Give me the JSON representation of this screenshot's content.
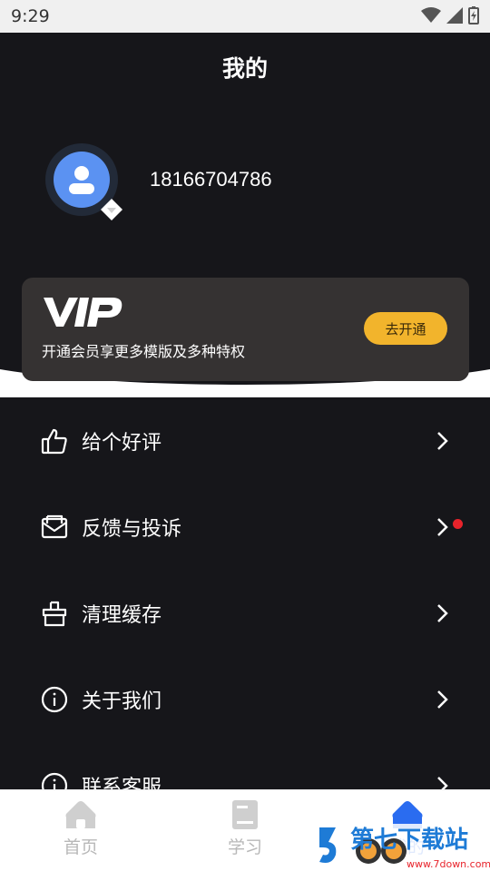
{
  "status_bar": {
    "time": "9:29"
  },
  "header": {
    "title": "我的"
  },
  "profile": {
    "phone": "18166704786"
  },
  "vip_card": {
    "logo_text": "VIP",
    "subtitle": "开通会员享更多模版及多种特权",
    "button_label": "去开通"
  },
  "menu": {
    "items": [
      {
        "label": "给个好评",
        "icon": "thumbs-up-icon"
      },
      {
        "label": "反馈与投诉",
        "icon": "feedback-mail-icon",
        "badge": "red-dot"
      },
      {
        "label": "清理缓存",
        "icon": "broom-icon"
      },
      {
        "label": "关于我们",
        "icon": "info-icon"
      },
      {
        "label": "联系客服",
        "icon": "info-icon"
      }
    ]
  },
  "bottom_nav": {
    "items": [
      {
        "label": "首页",
        "icon": "home-icon"
      },
      {
        "label": "学习",
        "icon": "book-icon"
      },
      {
        "label": "我的",
        "icon": "profile-house-icon",
        "active": true
      }
    ]
  },
  "watermark": {
    "text": "第七下载站",
    "url_text": "www.7down.com"
  },
  "colors": {
    "background": "#16161a",
    "accent": "#2a6cf0",
    "vip_button": "#f2b42c",
    "vip_card": "#353232",
    "badge": "#e8232b"
  }
}
